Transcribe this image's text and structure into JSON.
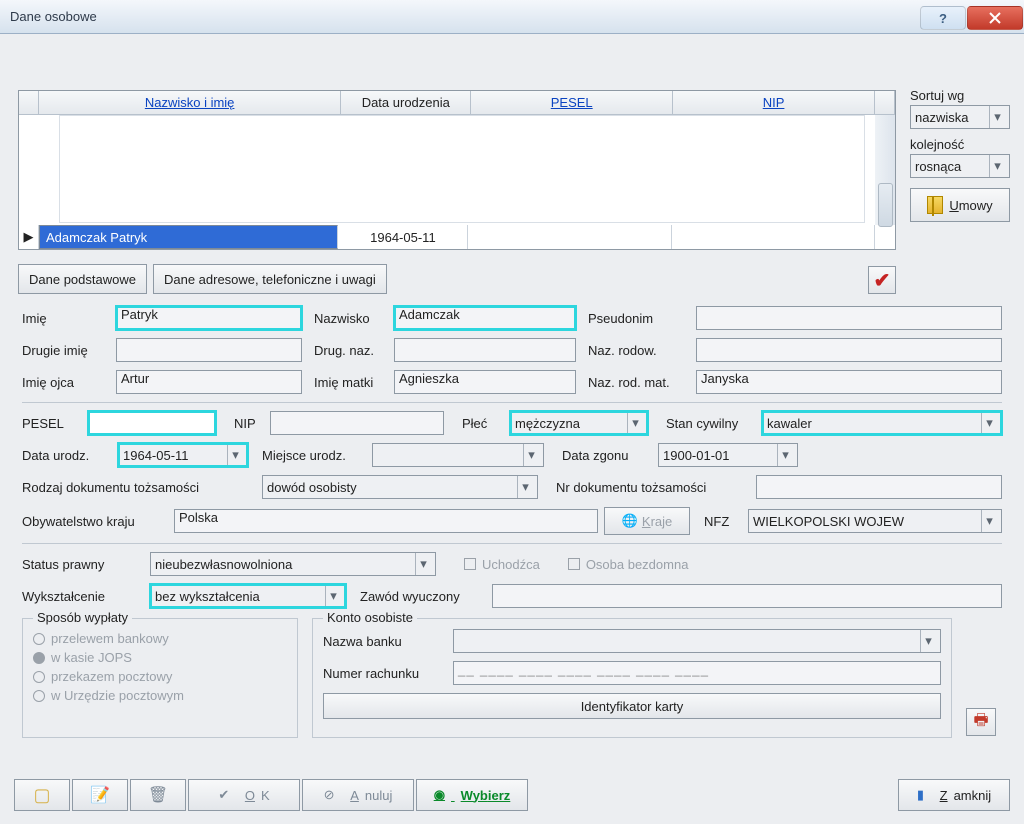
{
  "window": {
    "title": "Dane osobowe"
  },
  "sort": {
    "label1": "Sortuj wg",
    "value1": "nazwiska",
    "label2": "kolejność",
    "value2": "rosnąca"
  },
  "umowy": "Umowy",
  "grid": {
    "headers": {
      "name": "Nazwisko i imię",
      "birth": "Data urodzenia",
      "pesel": "PESEL",
      "nip": "NIP"
    },
    "row": {
      "name": "Adamczak Patryk",
      "birth": "1964-05-11"
    }
  },
  "tabs": {
    "t1": "Dane podstawowe",
    "t2": "Dane adresowe, telefoniczne i uwagi"
  },
  "f": {
    "imie_l": "Imię",
    "imie": "Patryk",
    "nazw_l": "Nazwisko",
    "nazw": "Adamczak",
    "pseud_l": "Pseudonim",
    "drugie_l": "Drugie imię",
    "drugn_l": "Drug. naz.",
    "rodow_l": "Naz. rodow.",
    "ojca_l": "Imię ojca",
    "ojca": "Artur",
    "matki_l": "Imię matki",
    "matki": "Agnieszka",
    "rodmat_l": "Naz. rod. mat.",
    "rodmat": "Janyska",
    "pesel_l": "PESEL",
    "nip_l": "NIP",
    "plec_l": "Płeć",
    "plec": "mężczyzna",
    "stan_l": "Stan cywilny",
    "stan": "kawaler",
    "dur_l": "Data urodz.",
    "dur": "1964-05-11",
    "mur_l": "Miejsce urodz.",
    "dzg_l": "Data zgonu",
    "dzg": "1900-01-01",
    "dok_l": "Rodzaj dokumentu tożsamości",
    "dok": "dowód osobisty",
    "nrdok_l": "Nr dokumentu tożsamości",
    "obyw_l": "Obywatelstwo kraju",
    "obyw": "Polska",
    "kraje": "Kraje",
    "nfz_l": "NFZ",
    "nfz": "WIELKOPOLSKI WOJEW",
    "status_l": "Status prawny",
    "status": "nieubezwłasnowolniona",
    "uch": "Uchodźca",
    "bezd": "Osoba bezdomna",
    "wyk_l": "Wykształcenie",
    "wyk": "bez wykształcenia",
    "zaw_l": "Zawód wyuczony",
    "sposob": "Sposób wypłaty",
    "r1": "przelewem bankowy",
    "r2": "w kasie JOPS",
    "r3": "przekazem pocztowy",
    "r4": "w Urzędzie pocztowym",
    "konto": "Konto osobiste",
    "bank_l": "Nazwa banku",
    "rach_l": "Numer rachunku",
    "ident": "Identyfikator karty"
  },
  "b": {
    "ok": "OK",
    "anuluj": "Anuluj",
    "wybierz": "Wybierz",
    "zamknij": "Zamknij"
  }
}
